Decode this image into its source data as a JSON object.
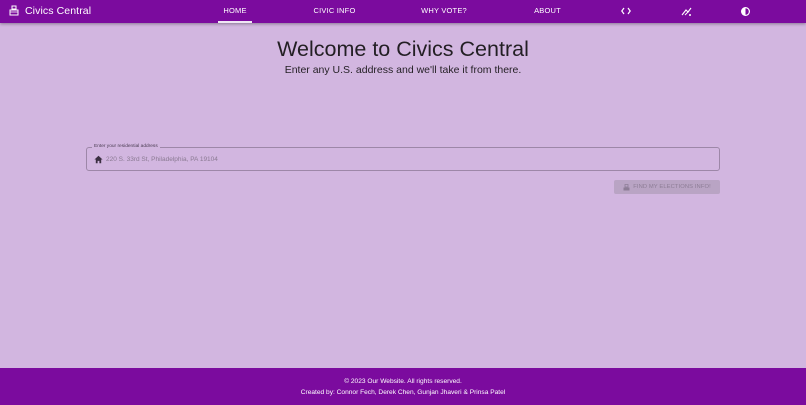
{
  "nav": {
    "brand": "Civics Central",
    "links": [
      {
        "label": "HOME",
        "active": true
      },
      {
        "label": "CIVIC INFO",
        "active": false
      },
      {
        "label": "WHY VOTE?",
        "active": false
      },
      {
        "label": "ABOUT",
        "active": false
      }
    ],
    "icons": [
      "code-icon",
      "github-icon",
      "theme-toggle-icon"
    ]
  },
  "hero": {
    "title": "Welcome to Civics Central",
    "subtitle": "Enter any U.S. address and we'll take it from there."
  },
  "address_field": {
    "label": "Enter your residential address",
    "placeholder": "220 S. 33rd St, Philadelphia, PA 19104",
    "value": ""
  },
  "submit": {
    "label": "FIND MY ELECTIONS INFO!",
    "disabled": true
  },
  "footer": {
    "copyright": "© 2023   Our Website. All rights reserved.",
    "credits": "Created by: Connor Fech, Derek Chen, Gunjan Jhaveri & Prinsa Patel"
  },
  "colors": {
    "primary": "#7b0b9e",
    "background": "#d2b6e0",
    "button_disabled": "#b9a4c4"
  }
}
